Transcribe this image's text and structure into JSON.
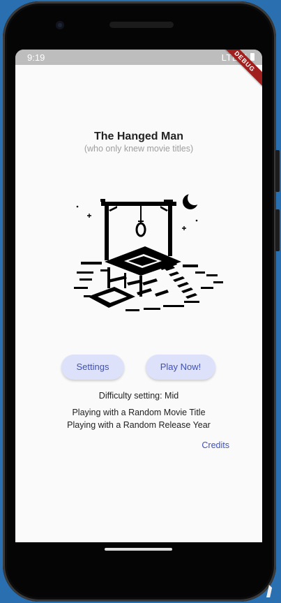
{
  "status_bar": {
    "time": "9:19",
    "network": "LTE",
    "debug_label": "DEBUG"
  },
  "header": {
    "title": "The Hanged Man",
    "subtitle": "(who only knew movie titles)"
  },
  "illustration": {
    "icon": "gallows-illustration"
  },
  "buttons": {
    "settings_label": "Settings",
    "play_label": "Play Now!"
  },
  "info": {
    "difficulty": "Difficulty setting: Mid",
    "movie_title": "Playing with a Random Movie Title",
    "release_year": "Playing with a Random Release Year"
  },
  "footer": {
    "credits_label": "Credits"
  },
  "colors": {
    "accent": "#3f51b5",
    "button_bg": "#dde1fa",
    "background": "#fafafa",
    "status_bar": "#bdbdbd",
    "debug_ribbon": "#a02020"
  }
}
